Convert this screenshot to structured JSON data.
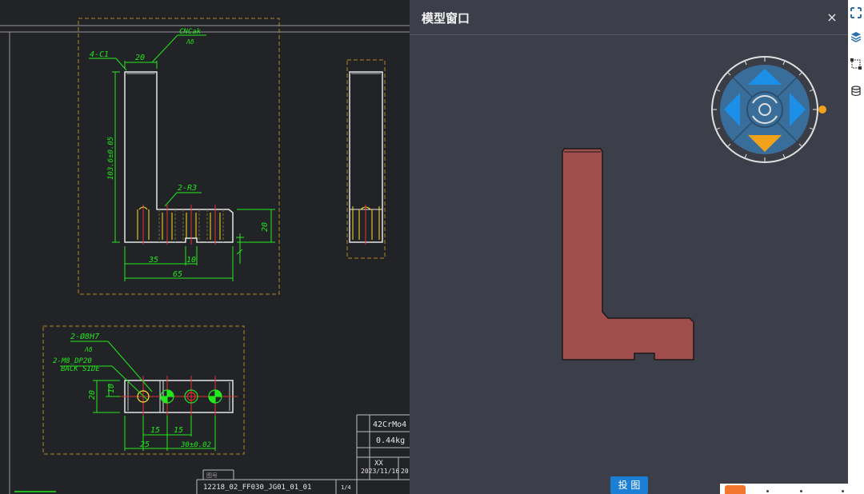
{
  "model_window": {
    "title": "模型窗口",
    "close_label": "×",
    "project_button_label": "投 图",
    "part_color": "#a04d4d"
  },
  "drawing": {
    "annotations": {
      "chamfer_note": "4-C1",
      "surface_note": "CNCak",
      "surface_sub": "Λδ",
      "top_width": "20",
      "height_dim": "103.6±0.05",
      "radius_note": "2-R3",
      "dim_35": "35",
      "dim_10": "10",
      "dim_65": "65",
      "dim_20_right": "20",
      "hole_note": "2-Ø8H7",
      "hole_sub": "Λδ",
      "thread_note": "2-M8_DP20",
      "back_side": "BACK SIDE",
      "dim_20_left": "20",
      "dim_10_left": "10",
      "dim_15a": "15",
      "dim_15b": "15",
      "dim_25": "25",
      "dim_30": "30±0.02"
    },
    "title_block": {
      "material": "42CrMo4",
      "weight": "0.44kg",
      "designer": "XX",
      "date": "2023/11/16",
      "date_cut": "20",
      "drawing_number": "12218_02_FF030_JG01_01_01",
      "page": "1/4",
      "label_small": "图号"
    },
    "colors": {
      "background": "#212326",
      "geometry": "#e6e6e6",
      "dimension": "#22e81c",
      "frame": "#b08a23",
      "accent_yellow": "#ffdf2b",
      "accent_red": "#e03030"
    }
  },
  "nav_cube": {
    "arrow_color": "#1c8fe8",
    "down_arrow_color": "#f0a21a"
  }
}
